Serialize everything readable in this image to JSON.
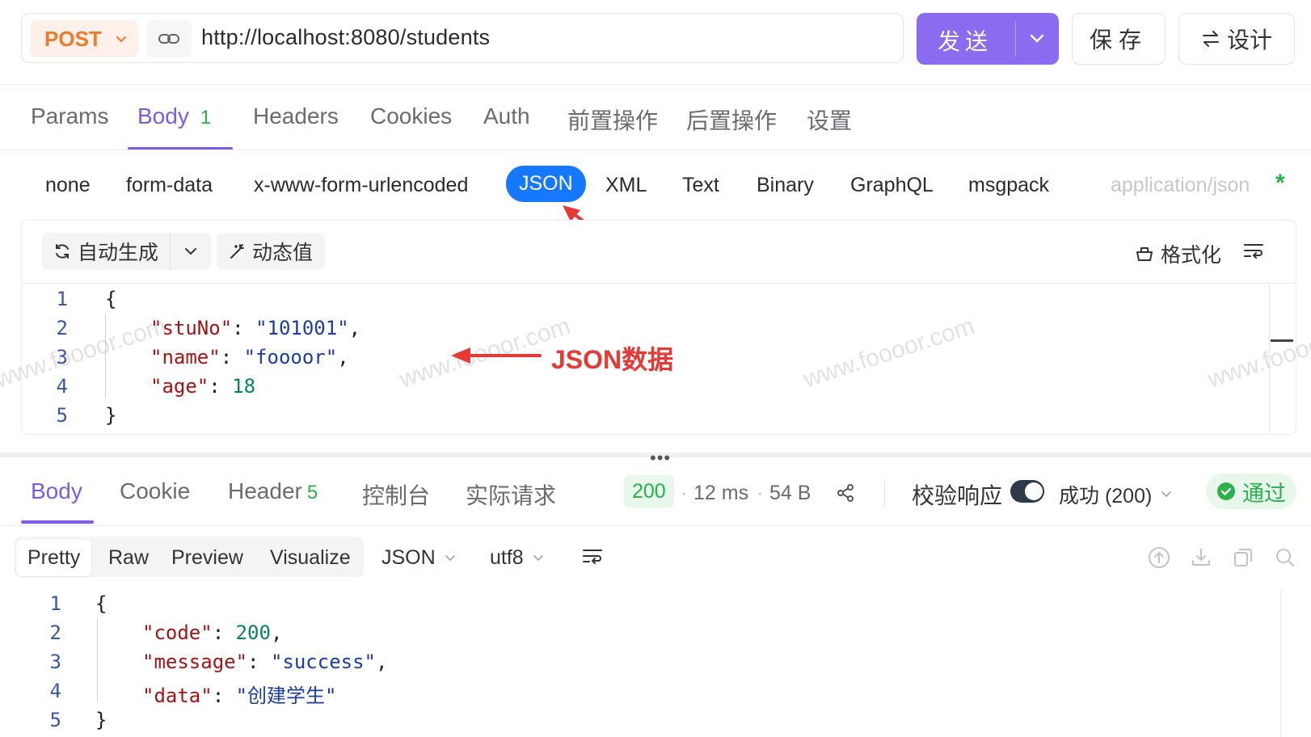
{
  "request": {
    "method": "POST",
    "url": "http://localhost:8080/students",
    "send_label": "发送",
    "save_label": "保存",
    "design_label": "设计"
  },
  "request_tabs": [
    {
      "label": "Params"
    },
    {
      "label": "Body",
      "badge": "1"
    },
    {
      "label": "Headers"
    },
    {
      "label": "Cookies"
    },
    {
      "label": "Auth"
    },
    {
      "label": "前置操作"
    },
    {
      "label": "后置操作"
    },
    {
      "label": "设置"
    }
  ],
  "body_types": [
    "none",
    "form-data",
    "x-www-form-urlencoded",
    "JSON",
    "XML",
    "Text",
    "Binary",
    "GraphQL",
    "msgpack"
  ],
  "content_type": "application/json",
  "required_marker": "*",
  "editor_toolbar": {
    "auto_generate": "自动生成",
    "dynamic_value": "动态值",
    "format": "格式化"
  },
  "request_body": {
    "line_numbers": [
      "1",
      "2",
      "3",
      "4",
      "5"
    ],
    "open": "{",
    "close": "}",
    "fields": [
      {
        "key": "\"stuNo\"",
        "value": "\"101001\"",
        "trail": ","
      },
      {
        "key": "\"name\"",
        "value": "\"foooor\"",
        "trail": ","
      },
      {
        "key": "\"age\"",
        "value": "18",
        "trail": ""
      }
    ]
  },
  "annotation": {
    "text": "JSON数据"
  },
  "watermark": "www.foooor.com",
  "response_tabs": [
    {
      "label": "Body"
    },
    {
      "label": "Cookie"
    },
    {
      "label": "Header",
      "badge": "5"
    },
    {
      "label": "控制台"
    },
    {
      "label": "实际请求"
    }
  ],
  "response_meta": {
    "status_code": "200",
    "time": "12 ms",
    "size": "54 B",
    "validate_label": "校验响应",
    "success_label": "成功 (200)",
    "pass_label": "通过"
  },
  "response_view": {
    "modes": [
      "Pretty",
      "Raw",
      "Preview",
      "Visualize"
    ],
    "format": "JSON",
    "encoding": "utf8"
  },
  "response_body": {
    "line_numbers": [
      "1",
      "2",
      "3",
      "4",
      "5"
    ],
    "open": "{",
    "close": "}",
    "fields": [
      {
        "key": "\"code\"",
        "value": "200",
        "trail": ","
      },
      {
        "key": "\"message\"",
        "value": "\"success\"",
        "trail": ","
      },
      {
        "key": "\"data\"",
        "value": "\"创建学生\"",
        "trail": ""
      }
    ]
  },
  "colors": {
    "accent": "#7c5ce6",
    "send_button": "#8b6cf0",
    "method": "#f07a2c",
    "json_pill": "#1677ff",
    "success": "#2bb04b",
    "annotation": "#e53935"
  }
}
